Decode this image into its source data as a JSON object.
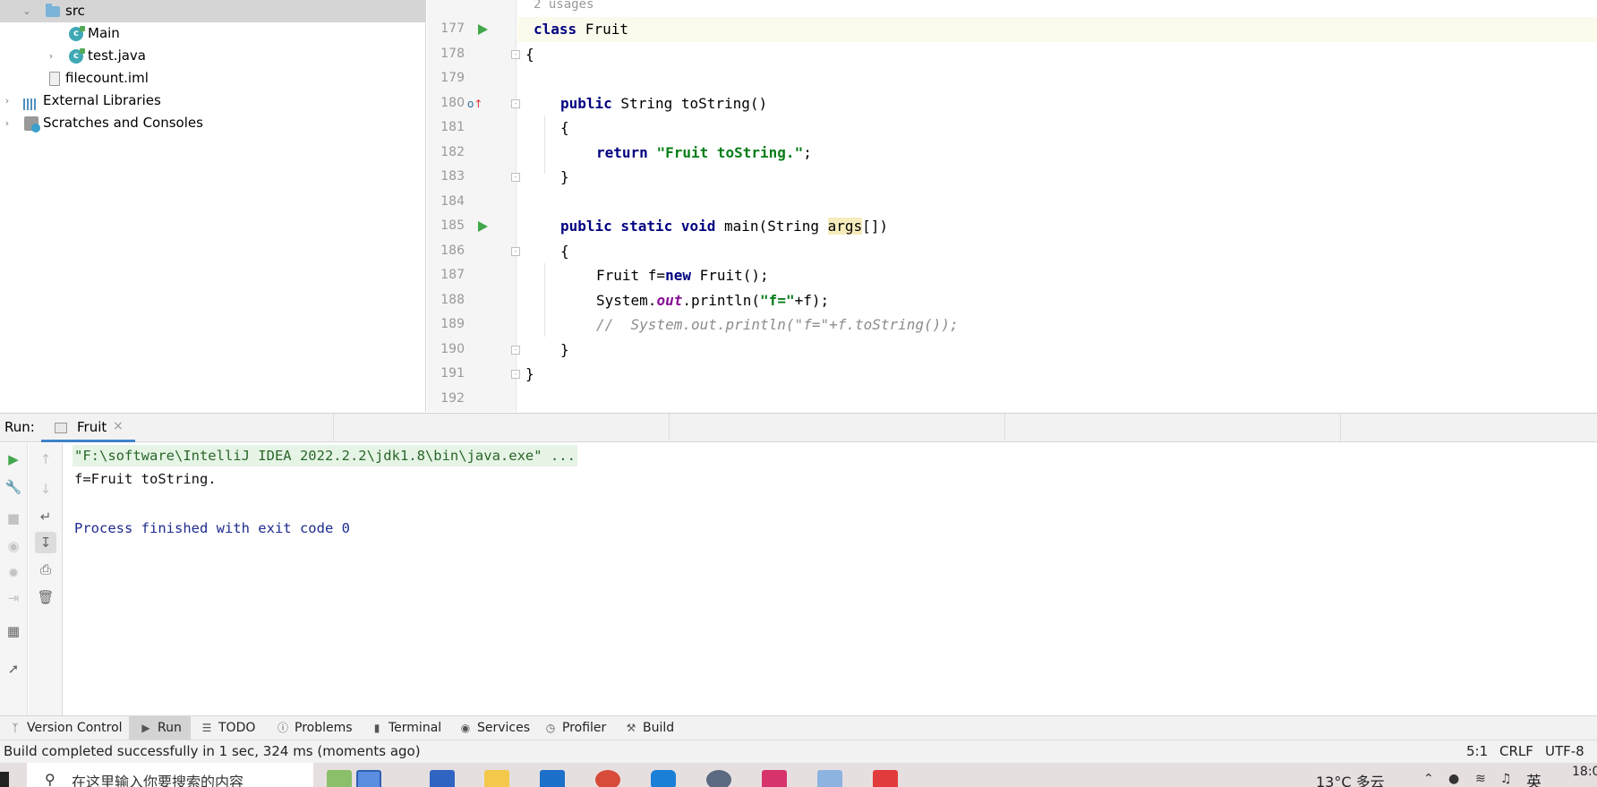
{
  "project_tree": {
    "items": [
      {
        "label": "src"
      },
      {
        "label": "Main"
      },
      {
        "label": "test.java"
      },
      {
        "label": "filecount.iml"
      },
      {
        "label": "External Libraries"
      },
      {
        "label": "Scratches and Consoles"
      }
    ]
  },
  "editor": {
    "usages_hint": "2 usages",
    "line_numbers": [
      "177",
      "178",
      "179",
      "180",
      "181",
      "182",
      "183",
      "184",
      "185",
      "186",
      "187",
      "188",
      "189",
      "190",
      "191",
      "192"
    ],
    "code": {
      "l177_kw": "class",
      "l177_name": " Fruit",
      "l178": "{",
      "l180_kw": "public",
      "l180_rest": " String toString()",
      "l181": "{",
      "l182_kw": "return",
      "l182_str": "\"Fruit toString.\"",
      "l182_end": ";",
      "l183": "}",
      "l185_kw": "public static void",
      "l185_mid": " main(String ",
      "l185_arg": "args",
      "l185_end": "[])",
      "l186": "{",
      "l187_a": "Fruit f=",
      "l187_kw": "new",
      "l187_b": " Fruit();",
      "l188_a": "System.",
      "l188_field": "out",
      "l188_b": ".println(",
      "l188_str": "\"f=\"",
      "l188_c": "+f);",
      "l189_comment": "//  System.out.println(\"f=\"+f.toString());",
      "l190": "}",
      "l191": "}"
    }
  },
  "run_panel": {
    "label": "Run:",
    "tab_label": "Fruit",
    "tab_close": "×",
    "console": {
      "command_line": "\"F:\\software\\IntelliJ IDEA 2022.2.2\\jdk1.8\\bin\\java.exe\" ...",
      "output_line": "f=Fruit toString.",
      "exit_line": "Process finished with exit code 0"
    }
  },
  "tool_strip": {
    "items": [
      {
        "label": "Version Control",
        "icon": "branch-icon"
      },
      {
        "label": "Run",
        "icon": "play-icon"
      },
      {
        "label": "TODO",
        "icon": "list-icon"
      },
      {
        "label": "Problems",
        "icon": "info-icon"
      },
      {
        "label": "Terminal",
        "icon": "terminal-icon"
      },
      {
        "label": "Services",
        "icon": "services-icon"
      },
      {
        "label": "Profiler",
        "icon": "profiler-icon"
      },
      {
        "label": "Build",
        "icon": "hammer-icon"
      }
    ]
  },
  "status_bar": {
    "message": "Build completed successfully in 1 sec, 324 ms (moments ago)",
    "position": "5:1",
    "line_separator": "CRLF",
    "encoding": "UTF-8"
  },
  "taskbar": {
    "search_placeholder": "在这里输入你要搜索的内容",
    "weather": "13°C 多云",
    "ime_language": "英",
    "clock": "18:0"
  },
  "colors": {
    "keyword": "#000080",
    "string": "#067d17",
    "run_marker": "#40a74a",
    "active_tab_underline": "#4083c9",
    "exit_text": "#1e2b8d"
  }
}
